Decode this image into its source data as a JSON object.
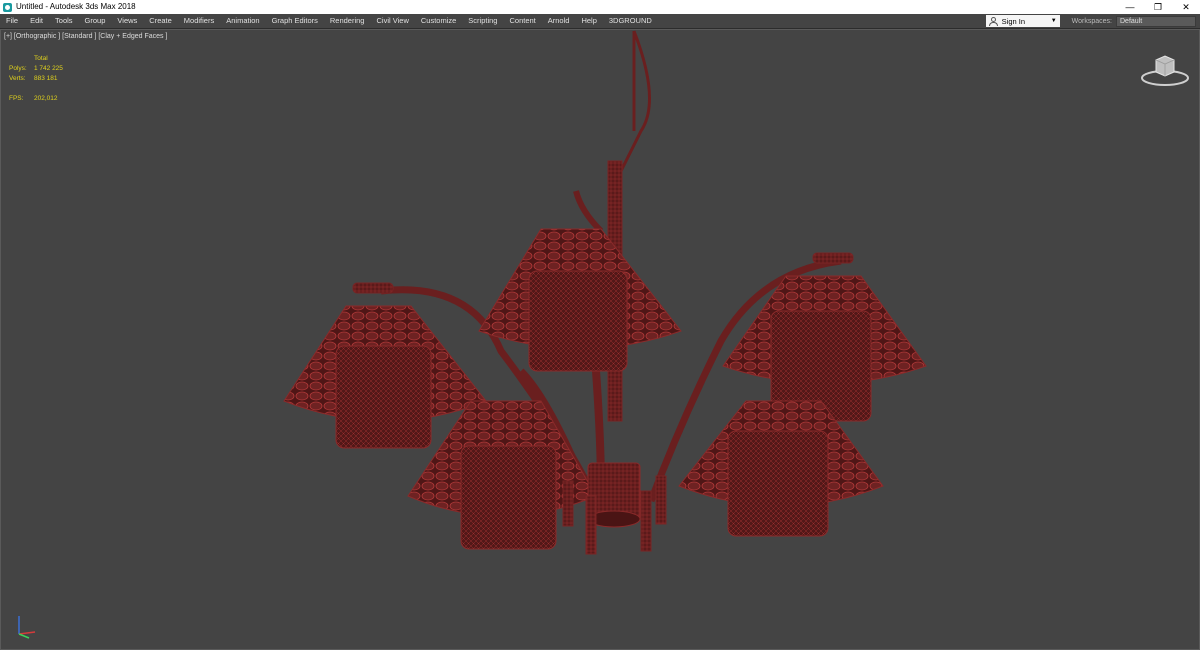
{
  "window": {
    "title": "Untitled - Autodesk 3ds Max 2018",
    "app_icon": "3dsmax-icon",
    "controls": {
      "minimize": "—",
      "restore": "❐",
      "close": "✕"
    }
  },
  "menu": {
    "items": [
      "File",
      "Edit",
      "Tools",
      "Group",
      "Views",
      "Create",
      "Modifiers",
      "Animation",
      "Graph Editors",
      "Rendering",
      "Civil View",
      "Customize",
      "Scripting",
      "Content",
      "Arnold",
      "Help",
      "3DGROUND"
    ],
    "sign_in": {
      "label": "Sign In",
      "icon": "user-icon"
    },
    "workspaces": {
      "label": "Workspaces:",
      "value": "Default"
    }
  },
  "viewport": {
    "label": "[+] [Orthographic ] [Standard ] [Clay + Edged Faces ]",
    "stats": {
      "total_label": "Total",
      "polys_label": "Polys:",
      "polys_value": "1 742 225",
      "verts_label": "Verts:",
      "verts_value": "883 181",
      "fps_label": "FPS:",
      "fps_value": "202,012"
    },
    "colors": {
      "background": "#444444",
      "mesh_fill": "#5a1a1a",
      "mesh_wire": "#a83232",
      "stats_text": "#e0d21c"
    },
    "viewcube_icon": "viewcube-icon",
    "axis_icon": "axis-tripod-icon"
  }
}
